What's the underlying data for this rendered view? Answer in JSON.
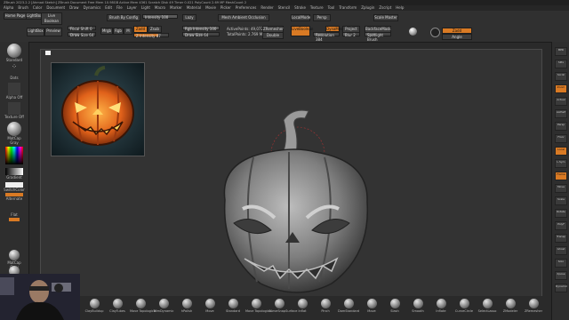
{
  "window": {
    "title": "ZBrush 2023.2.2 [Ahmad Sketch]  ZBrush Document   Free Mem 10.98GB  Active Mem 4361  Scratch Disk 49  Timer 0.021  PolyCount 2.69 MP  MeshCount 2"
  },
  "menu": [
    "Alpha",
    "Brush",
    "Color",
    "Document",
    "Draw",
    "Dynamics",
    "Edit",
    "File",
    "Layer",
    "Light",
    "Macro",
    "Marker",
    "Material",
    "Movie",
    "Picker",
    "Preferences",
    "Render",
    "Stencil",
    "Stroke",
    "Texture",
    "Tool",
    "Transform",
    "Zplugin",
    "Zscript",
    "Help"
  ],
  "toolbar": {
    "tabs_row": [
      "Home Page",
      "LightBox",
      "Live Boolean"
    ],
    "lightbox": "LightBox",
    "preview": "Preview",
    "shelf": {
      "left": "Shelf",
      "right": "Shelf"
    },
    "focal_shift": "Focal Shift 0",
    "draw_size": "Draw Size 64",
    "dynamic": "Dynamic",
    "rgb_intensity": "Rgb Intensity 100",
    "z_intensity": "Z Intensity 87",
    "z_add": "Zadd",
    "z_sub": "Zsub",
    "mrgb": "Mrgb",
    "rgb": "Rgb",
    "m": "M",
    "active_points": "ActivePoints: 49,072",
    "total_points": "TotalPoints: 2.769 Mil",
    "zremesher_guide": "ZRemesher Guide",
    "double": "Double",
    "local_mode": "LocalMode",
    "persp": "Persp",
    "floor": "Floor",
    "local_sym": "Local Sym",
    "live_boolean": "LiveBoolean",
    "dynamesh": "DynaMesh",
    "resolution": "Resolution 384",
    "sdiv": "SDiv 1",
    "project": "Project",
    "groups": "Groups",
    "polish": "Polish",
    "blur": "Blur 2",
    "backface_mask": "BackfaceMask",
    "spotlight": "Spotlight Brush",
    "scale_master": "Scale Master",
    "zadd_btn": "Zadd",
    "angle": "Angle",
    "brush_by_config": "Brush By Config",
    "intensity": "Intensity 100",
    "lazy_mouse": "Lazy",
    "mesh_ambient": "Mesh Ambient Occlusion"
  },
  "leftshelf": [
    {
      "label": "Standard",
      "icon": "brush-sphere-icon"
    },
    {
      "label": "Dots",
      "icon": "stroke-dots-icon"
    },
    {
      "label": "Alpha Off",
      "icon": "alpha-off-icon"
    },
    {
      "label": "Texture Off",
      "icon": "texture-off-icon"
    },
    {
      "label": "MatCap Gray",
      "icon": "material-sphere-icon"
    },
    {
      "label": "Gradient",
      "icon": "gradient-icon"
    },
    {
      "label": "SwitchColor",
      "icon": "switch-color-icon"
    },
    {
      "label": "Alternate",
      "icon": "alternate-icon"
    },
    {
      "label": "Flat",
      "icon": "flat-icon"
    },
    {
      "label": "MatCap Gray",
      "icon": "material-icon"
    },
    {
      "label": "Basic Material",
      "icon": "material2-icon"
    }
  ],
  "colors": {
    "accent": "#d97a24",
    "panel": "#303030",
    "canvas": "#333333",
    "bg": "#2a2a2a"
  },
  "bottomshelf": [
    "ClayBuildup",
    "ClayTubes",
    "Move Topological",
    "TrimDynamic",
    "hPolish",
    "Move",
    "Standard",
    "Move Topological",
    "CurveSnapSurface",
    "Inflat",
    "Pinch",
    "DamStandard",
    "Move",
    "Slash",
    "Smooth",
    "Inflate",
    "CurveCircle",
    "SelectLasso",
    "ZModeler",
    "ZRemesher"
  ],
  "rightshelf": [
    "BPR",
    "SPix",
    "Scroll",
    "Zoom",
    "Actual",
    "AAHalf",
    "Persp",
    "Floor",
    "Local",
    "L.Sym",
    "Frame",
    "Move",
    "Scale",
    "Rotate",
    "PolyF",
    "Transp",
    "Ghost",
    "Solo",
    "Xpose",
    "Dynamic"
  ]
}
